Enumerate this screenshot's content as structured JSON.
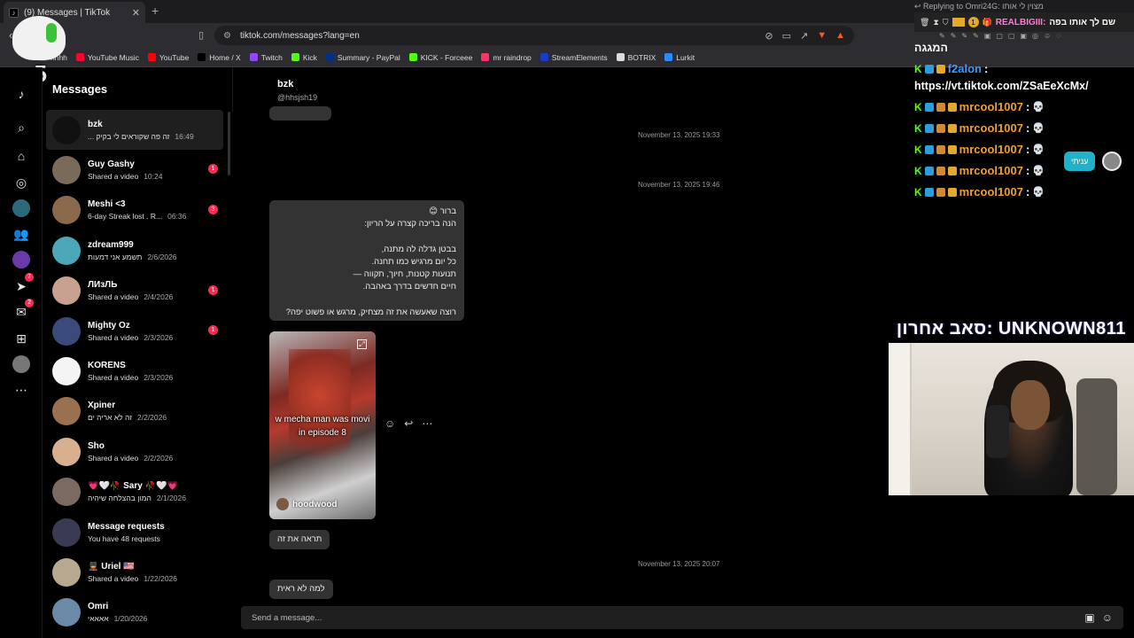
{
  "browser": {
    "tab_title": "(9) Messages | TikTok",
    "url": "tiktok.com/messages?lang=en",
    "bookmarks": [
      {
        "label": "hhhh",
        "color": "#444444"
      },
      {
        "label": "YouTube Music",
        "color": "#ff0033"
      },
      {
        "label": "YouTube",
        "color": "#ff0000"
      },
      {
        "label": "Home / X",
        "color": "#000000"
      },
      {
        "label": "Twitch",
        "color": "#9146ff"
      },
      {
        "label": "Kick",
        "color": "#53fc18"
      },
      {
        "label": "Summary - PayPal",
        "color": "#003087"
      },
      {
        "label": "KICK - Forceee",
        "color": "#53fc18"
      },
      {
        "label": "mr raindrop",
        "color": "#ff3366"
      },
      {
        "label": "StreamElements",
        "color": "#1a3cc8"
      },
      {
        "label": "BOTRIX",
        "color": "#dddddd"
      },
      {
        "label": "Lurkit",
        "color": "#2a8cff"
      }
    ]
  },
  "overlay_badge": "x5",
  "rail": {
    "explore_badge": "7",
    "messages_badge": "2"
  },
  "messages_title": "Messages",
  "conversations": [
    {
      "name": "bzk",
      "preview": "... זה פה שקוראים לי בקיק",
      "time": "16:49",
      "unread": "",
      "avatar_color": "#111111",
      "active": true
    },
    {
      "name": "Guy Gashy",
      "preview": "Shared a video",
      "time": "10:24",
      "unread": "1",
      "avatar_color": "#7a6a5a",
      "active": false
    },
    {
      "name": "Meshi <3",
      "preview": "6-day Streak lost . R...",
      "time": "06:36",
      "unread": "3",
      "avatar_color": "#8a6a4a",
      "active": false
    },
    {
      "name": "zdream999",
      "preview": "תשמע אני דמעות",
      "time": "2/6/2026",
      "unread": "",
      "avatar_color": "#4aa8b8",
      "active": false
    },
    {
      "name": "ЛИзЛЬ",
      "preview": "Shared a video",
      "time": "2/4/2026",
      "unread": "1",
      "avatar_color": "#c8a090",
      "active": false
    },
    {
      "name": "Mighty Oz",
      "preview": "Shared a video",
      "time": "2/3/2026",
      "unread": "1",
      "avatar_color": "#3a4a7a",
      "active": false
    },
    {
      "name": "KORENS",
      "preview": "Shared a video",
      "time": "2/3/2026",
      "unread": "",
      "avatar_color": "#f4f4f4",
      "active": false
    },
    {
      "name": "Xpiner",
      "preview": "זה לא אריה ים",
      "time": "2/2/2026",
      "unread": "",
      "avatar_color": "#9a7050",
      "active": false
    },
    {
      "name": "Sho",
      "preview": "Shared a video",
      "time": "2/2/2026",
      "unread": "",
      "avatar_color": "#d8b090",
      "active": false
    },
    {
      "name": "💗🤍🥀 Sary 🥀🤍💗",
      "preview": "המון בהצלחה שיהיה",
      "time": "2/1/2026",
      "unread": "",
      "avatar_color": "#7a6a60",
      "active": false
    },
    {
      "name": "Message requests",
      "preview": "You have 48 requests",
      "time": "",
      "unread": "",
      "avatar_color": "#3a3a55",
      "active": false
    },
    {
      "name": "💂 Uriel 🇺🇸",
      "preview": "Shared a video",
      "time": "1/22/2026",
      "unread": "",
      "avatar_color": "#b8a890",
      "active": false
    },
    {
      "name": "Omri",
      "preview": "אאאאי",
      "time": "1/20/2026",
      "unread": "",
      "avatar_color": "#6a8aa8",
      "active": false
    }
  ],
  "chat": {
    "name": "bzk",
    "handle": "@hhsjsh19",
    "date_1": "November 13, 2025 19:33",
    "date_2": "November 13, 2025 19:46",
    "long_message": "ברור 😊\nהנה בריכה קצרה על הריון:\n\nבבטן גדלה לה מתנה,\nכל יום מרגיש כמו תחנה.\nתנועות קטנות, חיוך, תקווה —\nחיים חדשים בדרך באהבה.\n\nרוצה שאעשה את זה מצחיק, מרגש או פשוט יפה?",
    "video_caption_1": "w mecha man was movi",
    "video_caption_2": "in episode 8",
    "video_author": "hoodwood",
    "reply_1": "תראה את זה",
    "date_3": "November 13, 2025 20:07",
    "reply_2": "למה לא ראית",
    "composer_placeholder": "Send a message..."
  },
  "stream_overlay": {
    "replying_to": "Replying to Omri24G: מצוין לי אותו",
    "reply_user": "REALBIGIII:",
    "reply_text": "שם לך אותו בפה",
    "top_text": "המגגה",
    "f2alon_user": "f2alon",
    "f2alon_link": "https://vt.tiktok.com/ZSaEeXcMx/",
    "repeat_user": "mrcool1007",
    "repeat_count_lines": [
      "mrcool1007",
      "mrcool1007",
      "mrcool1007",
      "mrcool1007",
      "mrcool1007"
    ],
    "pill_text": "עניתי",
    "last_sub": "סאב אחרון: UNKNOWN811"
  }
}
